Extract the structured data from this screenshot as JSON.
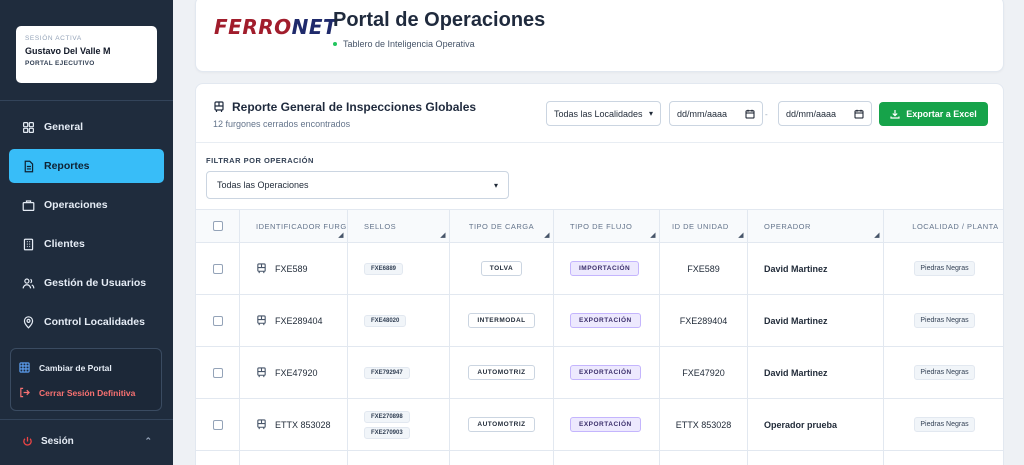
{
  "sidebar": {
    "session": {
      "label": "SESIÓN ACTIVA",
      "name": "Gustavo Del Valle M",
      "role": "PORTAL EJECUTIVO"
    },
    "nav": [
      {
        "label": "General",
        "icon": "grid-icon"
      },
      {
        "label": "Reportes",
        "icon": "document-icon",
        "active": true
      },
      {
        "label": "Operaciones",
        "icon": "briefcase-icon"
      },
      {
        "label": "Clientes",
        "icon": "building-icon"
      },
      {
        "label": "Gestión de Usuarios",
        "icon": "users-icon"
      },
      {
        "label": "Control Localidades",
        "icon": "map-pin-icon"
      }
    ],
    "change_portal": "Cambiar de Portal",
    "logout": "Cerrar Sesión Definitiva",
    "session_menu": "Sesión"
  },
  "header": {
    "logo_a": "FERRO",
    "logo_b": "NET",
    "title": "Portal de Operaciones",
    "subtitle": "Tablero de Inteligencia Operativa"
  },
  "report": {
    "title": "Reporte General de Inspecciones Globales",
    "count": "12 furgones cerrados encontrados",
    "location_select": "Todas las Localidades",
    "date_from": "dd/mm/aaaa",
    "date_sep": "-",
    "date_to": "dd/mm/aaaa",
    "export_label": "Exportar a Excel",
    "filter_label": "FILTRAR POR OPERACIÓN",
    "filter_value": "Todas las Operaciones"
  },
  "table": {
    "headers": {
      "id": "IDENTIFICADOR FURGÓN",
      "seals": "SELLOS",
      "cargo": "TIPO DE CARGA",
      "flow": "TIPO DE FLUJO",
      "unit": "ID DE UNIDAD",
      "operator": "OPERADOR",
      "location": "LOCALIDAD / PLANTA"
    },
    "rows": [
      {
        "id": "FXE589",
        "seals": [
          "FXE6889"
        ],
        "cargo": "TOLVA",
        "flow": "IMPORTACIÓN",
        "unit": "FXE589",
        "operator": "David Martinez",
        "location": "Piedras Negras"
      },
      {
        "id": "FXE289404",
        "seals": [
          "FXE48020"
        ],
        "cargo": "INTERMODAL",
        "flow": "EXPORTACIÓN",
        "unit": "FXE289404",
        "operator": "David Martinez",
        "location": "Piedras Negras"
      },
      {
        "id": "FXE47920",
        "seals": [
          "FXE792947"
        ],
        "cargo": "AUTOMOTRIZ",
        "flow": "EXPORTACIÓN",
        "unit": "FXE47920",
        "operator": "David Martinez",
        "location": "Piedras Negras"
      },
      {
        "id": "ETTX 853028",
        "seals": [
          "FXE270898",
          "FXE270903"
        ],
        "cargo": "AUTOMOTRIZ",
        "flow": "EXPORTACIÓN",
        "unit": "ETTX 853028",
        "operator": "Operador prueba",
        "location": "Piedras Negras"
      }
    ]
  },
  "colors": {
    "sidebar_bg": "#1f2c3d",
    "active_nav": "#38bdf8",
    "export_green": "#16a34a",
    "logout_red": "#f87171",
    "status_dot": "#22c55e"
  }
}
